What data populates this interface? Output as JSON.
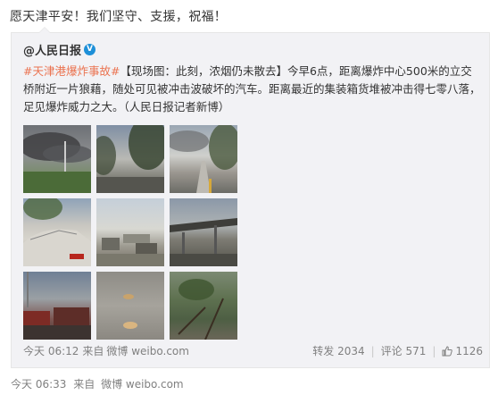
{
  "post": {
    "text": "愿天津平安！我们坚守、支援，祝福！"
  },
  "repost": {
    "author": "@人民日报",
    "verified_icon": "verified-badge-icon",
    "hashtag": "#天津港爆炸事故#",
    "body": "【现场图：此刻，浓烟仍未散去】今早6点，距离爆炸中心500米的立交桥附近一片狼藉，随处可见被冲击波破坏的汽车。距离最近的集装箱货堆被冲击得七零八落，足见爆炸威力之大。（人民日报记者新博）",
    "time": "今天 06:12",
    "source_prefix": "来自",
    "source": "微博 weibo.com",
    "repost_label": "转发 2034",
    "comment_label": "评论 571",
    "like_icon": "thumbs-up-icon",
    "like_count": "1126"
  },
  "bottom": {
    "time": "今天 06:33",
    "source_prefix": "来自",
    "source": "微博 weibo.com"
  }
}
